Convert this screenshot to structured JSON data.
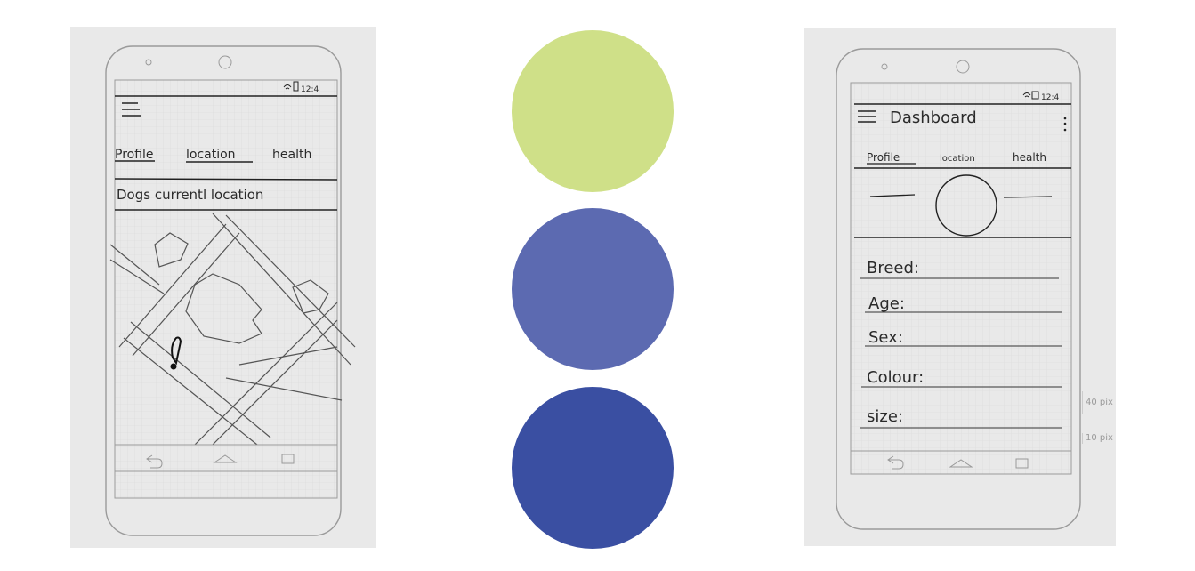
{
  "left_sketch": {
    "status": "12:4",
    "tabs": [
      "Profile",
      "location",
      "health"
    ],
    "heading": "Dogs currentl location"
  },
  "right_sketch": {
    "status": "12:4",
    "title": "Dashboard",
    "tabs": [
      "Profile",
      "location",
      "health"
    ],
    "fields": [
      "Breed:",
      "Age:",
      "Sex:",
      "Colour:",
      "size:"
    ]
  },
  "swatches": [
    {
      "color": "#cfe088"
    },
    {
      "color": "#5c6ab1"
    },
    {
      "color": "#3a4fa2"
    }
  ],
  "side_notes": [
    "40 pix",
    "10 pix"
  ]
}
